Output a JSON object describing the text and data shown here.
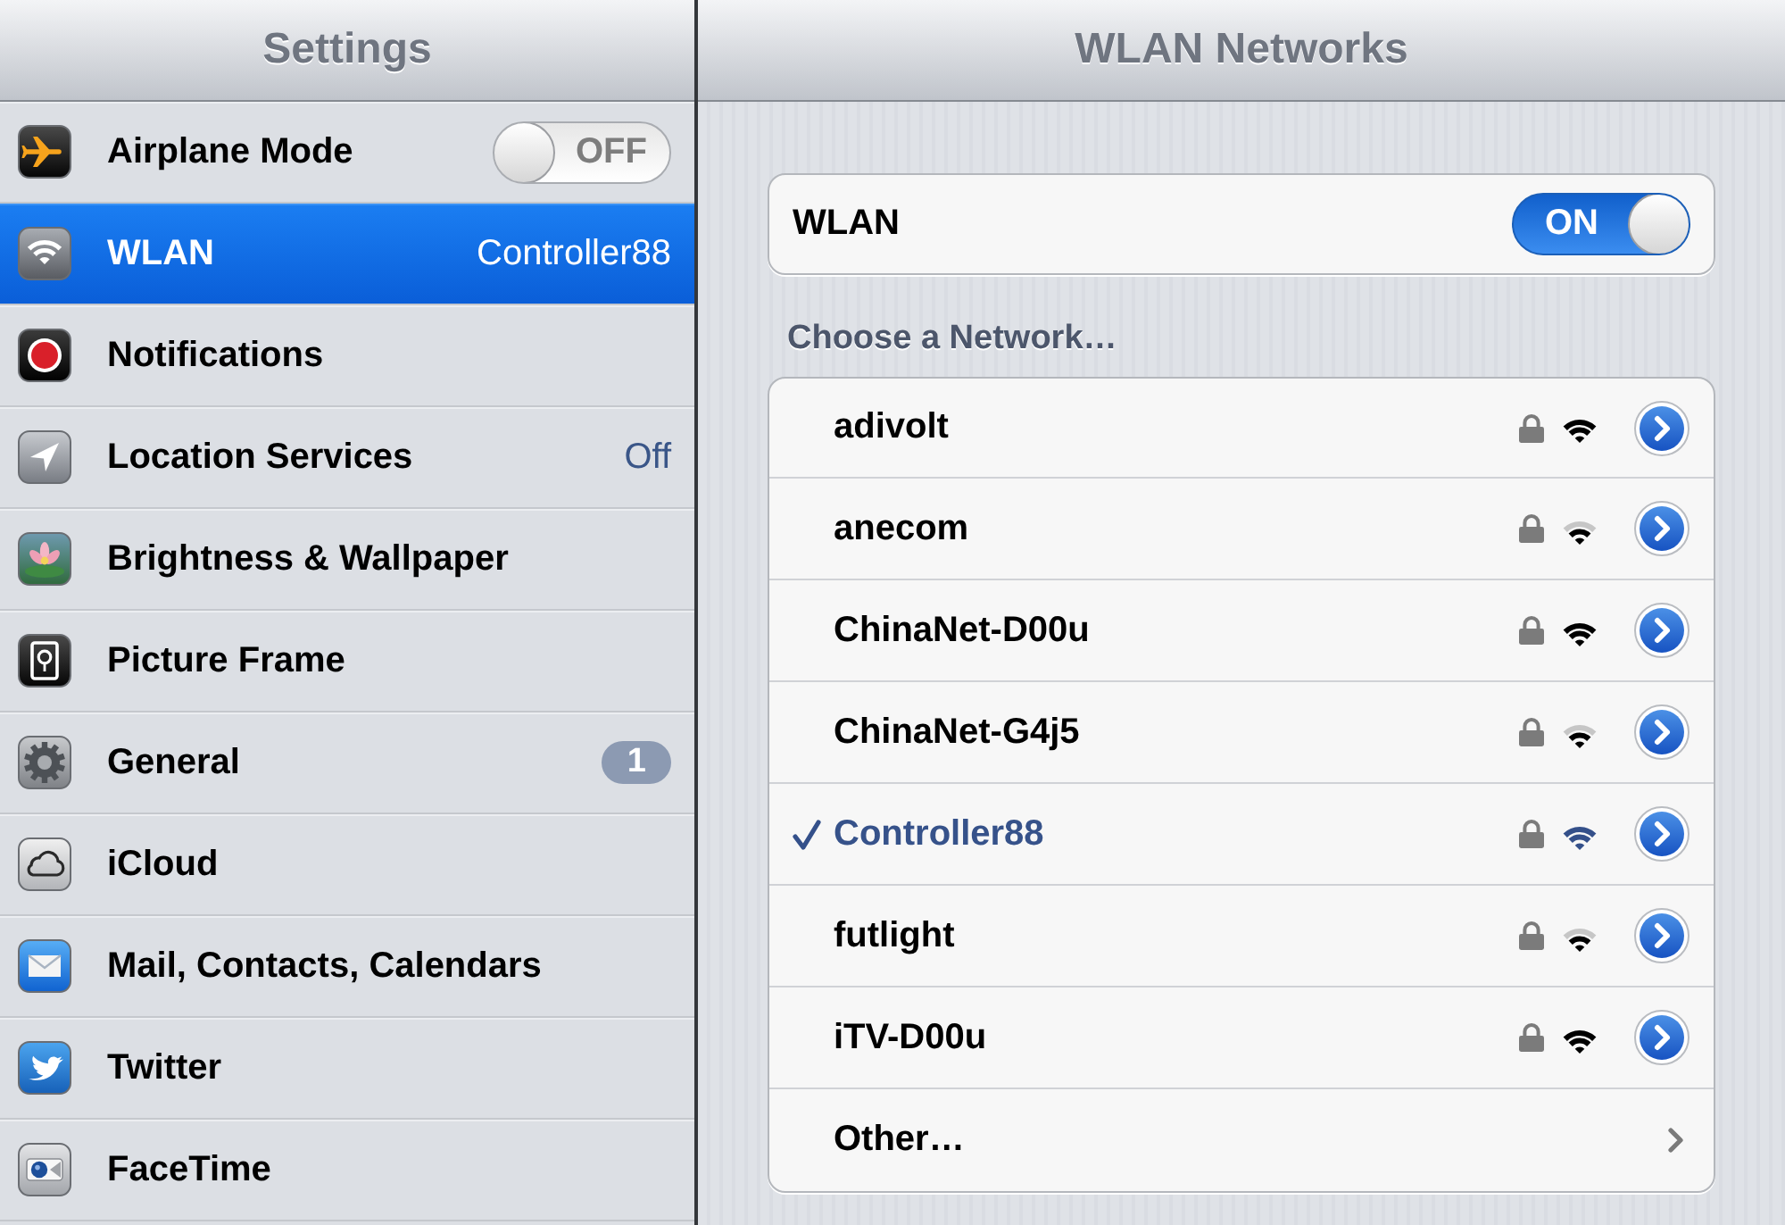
{
  "sidebar": {
    "title": "Settings",
    "items": [
      {
        "label": "Airplane Mode",
        "selected": false,
        "toggle": {
          "label": "OFF",
          "on": false
        }
      },
      {
        "label": "WLAN",
        "selected": true,
        "value": "Controller88"
      },
      {
        "label": "Notifications",
        "selected": false
      },
      {
        "label": "Location Services",
        "selected": false,
        "value": "Off"
      },
      {
        "label": "Brightness & Wallpaper",
        "selected": false
      },
      {
        "label": "Picture Frame",
        "selected": false
      },
      {
        "label": "General",
        "selected": false,
        "badge": "1"
      },
      {
        "label": "iCloud",
        "selected": false
      },
      {
        "label": "Mail, Contacts, Calendars",
        "selected": false
      },
      {
        "label": "Twitter",
        "selected": false
      },
      {
        "label": "FaceTime",
        "selected": false
      }
    ]
  },
  "detail": {
    "title": "WLAN Networks",
    "wlan": {
      "label": "WLAN",
      "toggle": {
        "label": "ON",
        "on": true
      }
    },
    "section_header": "Choose a Network…",
    "networks": [
      {
        "name": "adivolt",
        "selected": false,
        "secured": true,
        "weak_signal": false
      },
      {
        "name": "anecom",
        "selected": false,
        "secured": true,
        "weak_signal": true
      },
      {
        "name": "ChinaNet-D00u",
        "selected": false,
        "secured": true,
        "weak_signal": false
      },
      {
        "name": "ChinaNet-G4j5",
        "selected": false,
        "secured": true,
        "weak_signal": true
      },
      {
        "name": "Controller88",
        "selected": true,
        "secured": true,
        "weak_signal": false
      },
      {
        "name": "futlight",
        "selected": false,
        "secured": true,
        "weak_signal": true
      },
      {
        "name": "iTV-D00u",
        "selected": false,
        "secured": true,
        "weak_signal": false
      }
    ],
    "other": {
      "label": "Other…"
    }
  }
}
